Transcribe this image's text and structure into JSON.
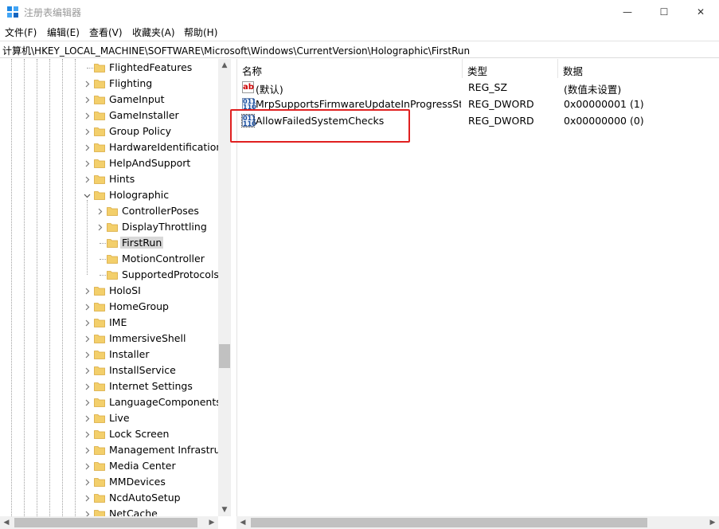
{
  "window": {
    "title": "注册表编辑器",
    "minimize_glyph": "—",
    "maximize_glyph": "☐",
    "close_glyph": "✕"
  },
  "menu": [
    "文件(F)",
    "编辑(E)",
    "查看(V)",
    "收藏夹(A)",
    "帮助(H)"
  ],
  "address": "计算机\\HKEY_LOCAL_MACHINE\\SOFTWARE\\Microsoft\\Windows\\CurrentVersion\\Holographic\\FirstRun",
  "tree": [
    {
      "label": "FlightedFeatures",
      "level": 0,
      "expander": "none"
    },
    {
      "label": "Flighting",
      "level": 0,
      "expander": "collapsed"
    },
    {
      "label": "GameInput",
      "level": 0,
      "expander": "collapsed"
    },
    {
      "label": "GameInstaller",
      "level": 0,
      "expander": "collapsed"
    },
    {
      "label": "Group Policy",
      "level": 0,
      "expander": "collapsed"
    },
    {
      "label": "HardwareIdentification",
      "level": 0,
      "expander": "collapsed"
    },
    {
      "label": "HelpAndSupport",
      "level": 0,
      "expander": "collapsed"
    },
    {
      "label": "Hints",
      "level": 0,
      "expander": "collapsed"
    },
    {
      "label": "Holographic",
      "level": 0,
      "expander": "expanded"
    },
    {
      "label": "ControllerPoses",
      "level": 1,
      "expander": "collapsed"
    },
    {
      "label": "DisplayThrottling",
      "level": 1,
      "expander": "collapsed"
    },
    {
      "label": "FirstRun",
      "level": 1,
      "expander": "none",
      "selected": true
    },
    {
      "label": "MotionController",
      "level": 1,
      "expander": "none"
    },
    {
      "label": "SupportedProtocols",
      "level": 1,
      "expander": "none"
    },
    {
      "label": "HoloSI",
      "level": 0,
      "expander": "collapsed"
    },
    {
      "label": "HomeGroup",
      "level": 0,
      "expander": "collapsed"
    },
    {
      "label": "IME",
      "level": 0,
      "expander": "collapsed"
    },
    {
      "label": "ImmersiveShell",
      "level": 0,
      "expander": "collapsed"
    },
    {
      "label": "Installer",
      "level": 0,
      "expander": "collapsed"
    },
    {
      "label": "InstallService",
      "level": 0,
      "expander": "collapsed"
    },
    {
      "label": "Internet Settings",
      "level": 0,
      "expander": "collapsed"
    },
    {
      "label": "LanguageComponentsI",
      "level": 0,
      "expander": "collapsed"
    },
    {
      "label": "Live",
      "level": 0,
      "expander": "collapsed"
    },
    {
      "label": "Lock Screen",
      "level": 0,
      "expander": "collapsed"
    },
    {
      "label": "Management Infrastruc",
      "level": 0,
      "expander": "collapsed"
    },
    {
      "label": "Media Center",
      "level": 0,
      "expander": "collapsed"
    },
    {
      "label": "MMDevices",
      "level": 0,
      "expander": "collapsed"
    },
    {
      "label": "NcdAutoSetup",
      "level": 0,
      "expander": "collapsed"
    },
    {
      "label": "NetCache",
      "level": 0,
      "expander": "collapsed"
    }
  ],
  "list": {
    "columns": [
      "名称",
      "类型",
      "数据"
    ],
    "rows": [
      {
        "icon": "string-value-icon",
        "icon_text": "ab",
        "name": "(默认)",
        "type": "REG_SZ",
        "data": "(数值未设置)"
      },
      {
        "icon": "binary-value-icon",
        "icon_text": "011\n110",
        "name": "MrpSupportsFirmwareUpdateInProgressSt...",
        "type": "REG_DWORD",
        "data": "0x00000001 (1)"
      },
      {
        "icon": "binary-value-icon",
        "icon_text": "011\n110",
        "name": "AllowFailedSystemChecks",
        "type": "REG_DWORD",
        "data": "0x00000000 (0)",
        "focused": true
      }
    ]
  },
  "colors": {
    "highlight_box": "#e02020",
    "selection": "#d9d9d9",
    "folder": "#f3cf6b"
  }
}
